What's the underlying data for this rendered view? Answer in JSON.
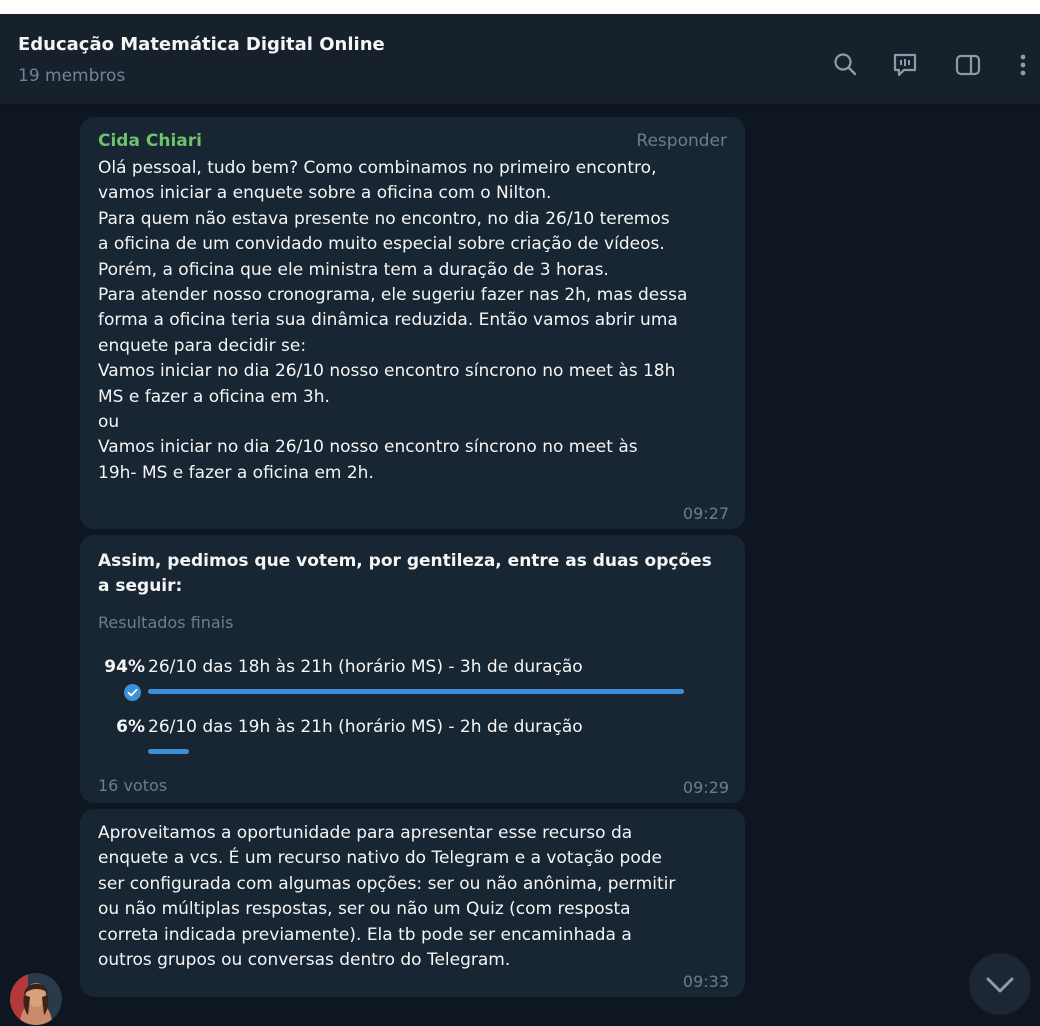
{
  "header": {
    "title": "Educação Matemática Digital Online",
    "subtitle": "19 membros",
    "icons": [
      "search-icon",
      "video-chat-icon",
      "sidebar-toggle-icon",
      "more-vertical-icon"
    ]
  },
  "messages": [
    {
      "sender": "Cida Chiari",
      "reply_label": "Responder",
      "text": "Olá pessoal, tudo bem? Como  combinamos no primeiro encontro,\nvamos iniciar a enquete sobre a oficina com o Nilton.\nPara quem não estava presente no encontro, no dia 26/10 teremos\na oficina de um convidado muito especial sobre criação de vídeos.\nPorém, a oficina que ele ministra tem a duração de 3 horas.\nPara atender nosso cronograma, ele sugeriu fazer nas 2h, mas dessa\nforma a oficina teria sua dinâmica reduzida. Então vamos abrir uma\nenquete para decidir se:\nVamos iniciar no dia 26/10 nosso encontro síncrono no meet às 18h\nMS e fazer a oficina em 3h.\nou\nVamos iniciar no dia 26/10 nosso encontro síncrono no meet às\n19h- MS e fazer a oficina em 2h.",
      "time": "09:27"
    },
    {
      "poll": {
        "question": "Assim, pedimos que votem, por gentileza, entre as duas opções a seguir:",
        "type_label": "Resultados finais",
        "options": [
          {
            "percent_label": "94%",
            "label": "26/10 das 18h às 21h (horário MS) - 3h de duração",
            "fraction": 0.94,
            "chosen": true
          },
          {
            "percent_label": "6%",
            "label": "26/10 das 19h às 21h (horário MS) - 2h de duração",
            "fraction": 0.06,
            "chosen": false
          }
        ],
        "votes_label": "16 votos"
      },
      "time": "09:29"
    },
    {
      "text": "Aproveitamos a oportunidade para apresentar esse recurso da\nenquete a vcs. É um recurso nativo do Telegram e a votação pode\nser configurada com algumas opções: ser ou não anônima, permitir\nou não múltiplas respostas, ser ou não um Quiz (com resposta\ncorreta indicada previamente). Ela tb pode ser encaminhada a\noutros grupos ou conversas dentro do Telegram.",
      "time": "09:33"
    }
  ],
  "colors": {
    "background": "#0e1621",
    "header": "#17212b",
    "bubble": "#182533",
    "sender_name": "#6fc16b",
    "accent": "#3e90d6",
    "muted": "#6b7d8f"
  }
}
